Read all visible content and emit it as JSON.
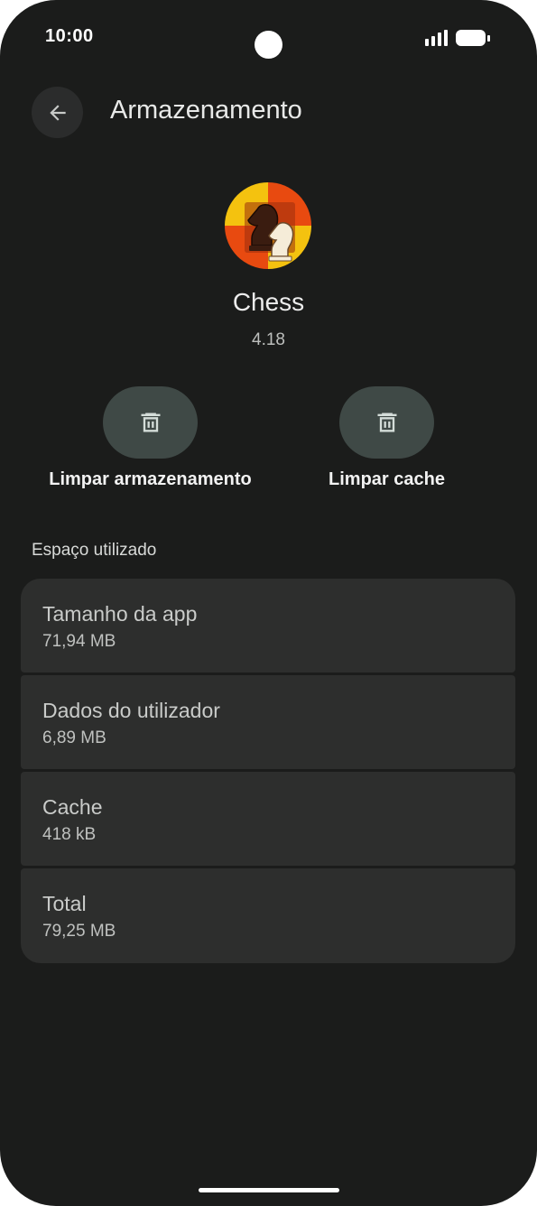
{
  "status_bar": {
    "time": "10:00"
  },
  "header": {
    "title": "Armazenamento",
    "back_icon": "arrow-left-icon"
  },
  "app": {
    "name": "Chess",
    "version": "4.18",
    "icon": "chess-knights-icon"
  },
  "actions": [
    {
      "label": "Limpar armazenamento",
      "icon": "trash-icon"
    },
    {
      "label": "Limpar cache",
      "icon": "trash-icon"
    }
  ],
  "storage": {
    "section_title": "Espaço utilizado",
    "rows": [
      {
        "title": "Tamanho da app",
        "value": "71,94 MB"
      },
      {
        "title": "Dados do utilizador",
        "value": "6,89 MB"
      },
      {
        "title": "Cache",
        "value": "418 kB"
      },
      {
        "title": "Total",
        "value": "79,25 MB"
      }
    ]
  },
  "colors": {
    "background": "#1b1c1b",
    "surface": "#2d2e2d",
    "action_button": "#3f4946",
    "icon_orange": "#e84a10",
    "icon_yellow": "#f4c20f"
  }
}
